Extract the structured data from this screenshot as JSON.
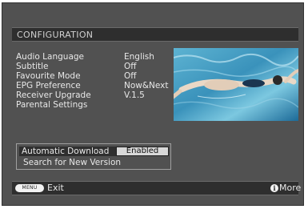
{
  "header": {
    "title": "CONFIGURATION"
  },
  "settings": [
    {
      "label": "Audio Language",
      "value": "English"
    },
    {
      "label": "Subtitle",
      "value": "Off"
    },
    {
      "label": "Favourite Mode",
      "value": "Off"
    },
    {
      "label": "EPG Preference",
      "value": "Now&Next"
    },
    {
      "label": "Receiver Upgrade",
      "value": "V.1.5"
    },
    {
      "label": "Parental Settings",
      "value": ""
    }
  ],
  "upgrade": {
    "automatic_download_label": "Automatic Download",
    "automatic_download_value": "Enabled",
    "search_label": "Search for New Version"
  },
  "footer": {
    "menu_key": "MENU",
    "exit_label": "Exit",
    "info_key": "i",
    "more_label": "More"
  },
  "icons": {
    "menu": "menu-button-icon",
    "info": "info-icon"
  },
  "colors": {
    "background": "#515151",
    "bar": "#2e2e2e",
    "text": "#e8e8e8",
    "selected_value_bg": "#d8d8d8"
  }
}
